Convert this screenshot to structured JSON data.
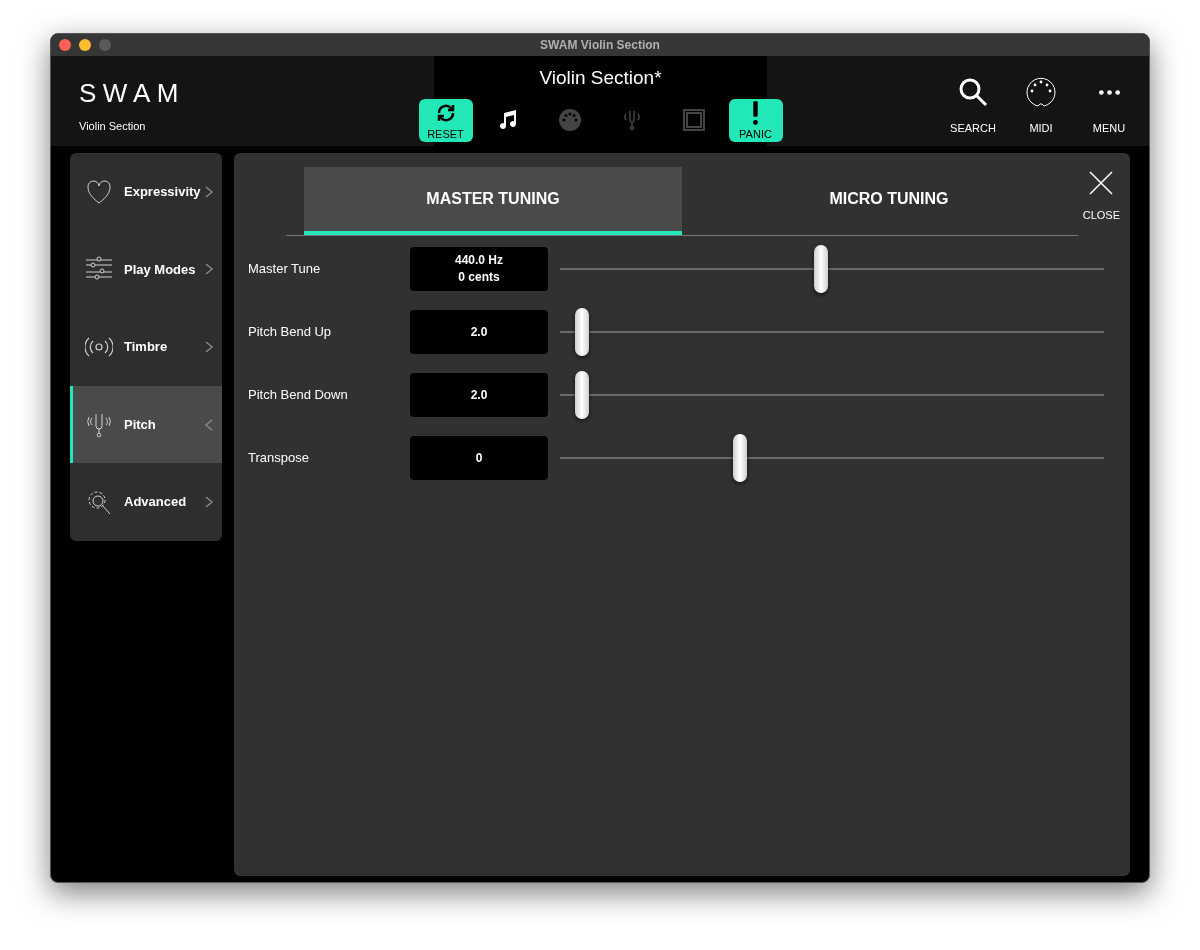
{
  "window": {
    "title": "SWAM Violin Section"
  },
  "header": {
    "logo": "SWAM",
    "subtitle": "Violin Section",
    "preset": "Violin Section*",
    "toolbar": [
      {
        "label": "RESET",
        "dimmed": false,
        "accent": true
      },
      {
        "dimmed": false,
        "accent": false
      },
      {
        "dimmed": true,
        "accent": false
      },
      {
        "dimmed": true,
        "accent": false
      },
      {
        "dimmed": true,
        "accent": false
      },
      {
        "label": "PANIC",
        "dimmed": false,
        "accent": true
      }
    ],
    "actions": [
      "SEARCH",
      "MIDI",
      "MENU"
    ]
  },
  "sidebar": {
    "items": [
      {
        "label": "Expressivity",
        "selected": false
      },
      {
        "label": "Play Modes",
        "selected": false
      },
      {
        "label": "Timbre",
        "selected": false
      },
      {
        "label": "Pitch",
        "selected": true
      },
      {
        "label": "Advanced",
        "selected": false
      }
    ]
  },
  "tabs": [
    {
      "label": "MASTER TUNING",
      "selected": true
    },
    {
      "label": "MICRO TUNING",
      "selected": false
    }
  ],
  "close": "CLOSE",
  "params": [
    {
      "name": "Master Tune",
      "value": [
        "440.0 Hz",
        "0 cents"
      ],
      "level": 0.48
    },
    {
      "name": "Pitch Bend Up",
      "value": [
        "2.0"
      ],
      "level": 0.04
    },
    {
      "name": "Pitch Bend Down",
      "value": [
        "2.0"
      ],
      "level": 0.04
    },
    {
      "name": "Transpose",
      "value": [
        "0"
      ],
      "level": 0.33
    }
  ]
}
